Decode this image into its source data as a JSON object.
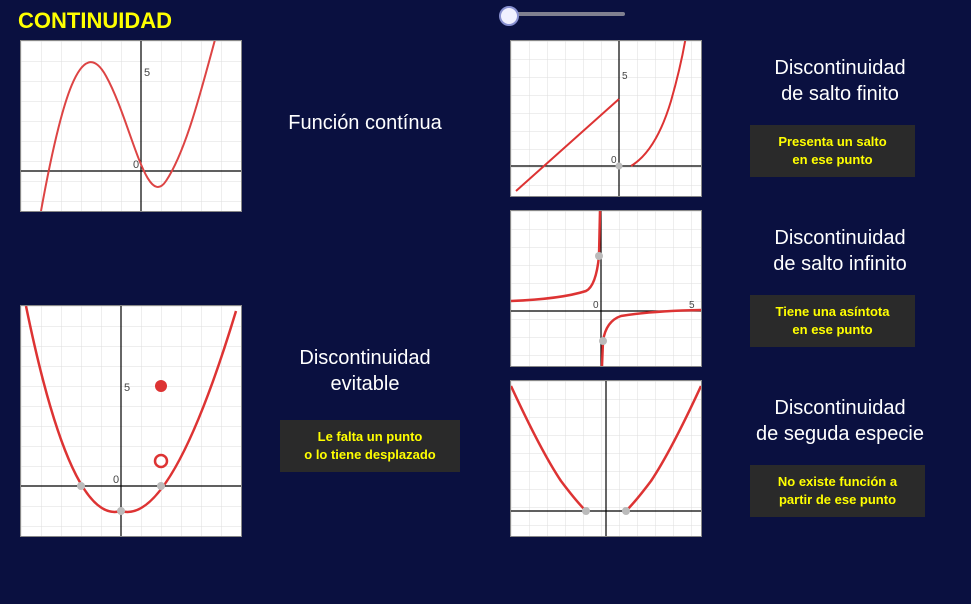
{
  "page_title": "CONTINUIDAD",
  "panels": {
    "continuous": {
      "title": "Función contínua",
      "axis_tick": "5"
    },
    "removable": {
      "title1": "Discontinuidad",
      "title2": "evitable",
      "note": "Le falta un punto\no lo tiene desplazado",
      "axis_tick": "5"
    },
    "finite_jump": {
      "title1": "Discontinuidad",
      "title2": "de salto finito",
      "note": "Presenta un salto\nen ese punto",
      "axis_tick": "5"
    },
    "infinite_jump": {
      "title1": "Discontinuidad",
      "title2": "de salto infinito",
      "note": "Tiene una asíntota\nen ese punto",
      "axis_tick": "5"
    },
    "second_kind": {
      "title1": "Discontinuidad",
      "title2": "de seguda especie",
      "note": "No existe función a\npartir de ese punto"
    }
  }
}
